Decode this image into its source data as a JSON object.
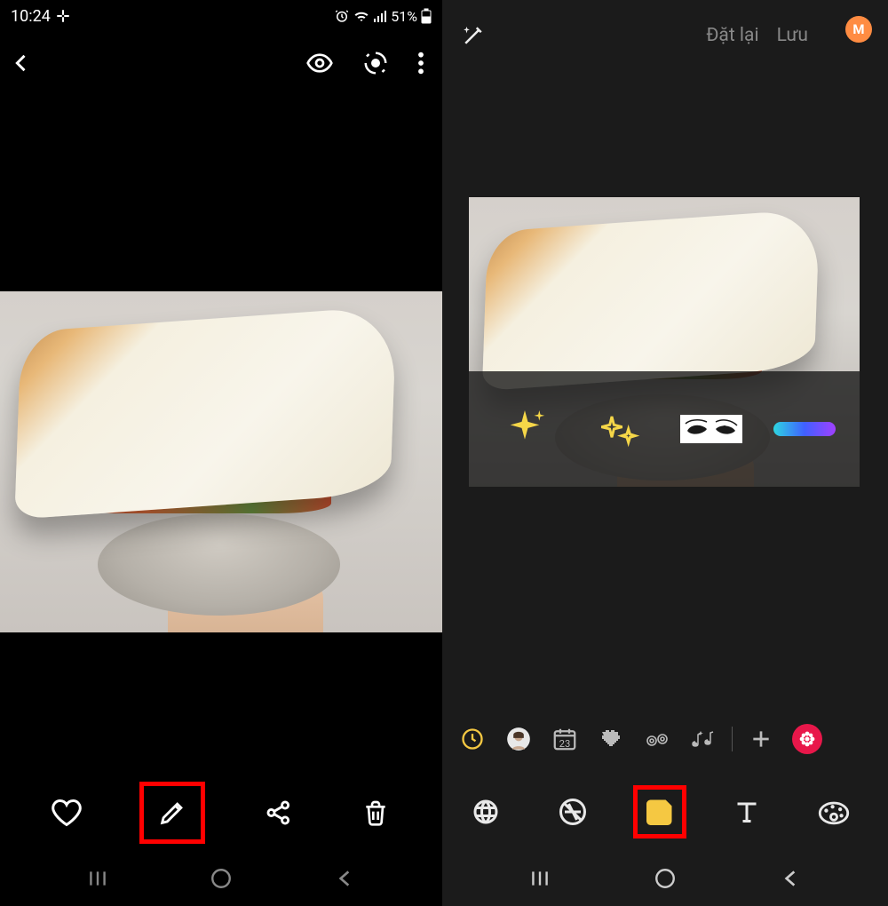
{
  "status": {
    "time": "10:24",
    "battery": "51%"
  },
  "editor_header": {
    "reset": "Đặt lại",
    "save": "Lưu",
    "profile_initial": "M"
  },
  "sticker_cats": {
    "date_num": "23"
  }
}
